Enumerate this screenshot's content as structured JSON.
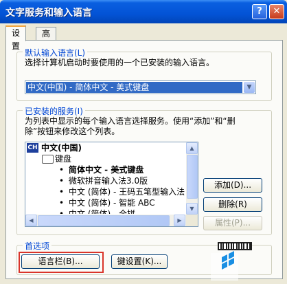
{
  "window": {
    "title": "文字服务和输入语言",
    "help_glyph": "?",
    "close_glyph": "✕"
  },
  "tabs": [
    {
      "label": "设置"
    },
    {
      "label": "高级"
    }
  ],
  "default_lang": {
    "legend": "默认输入语言(L)",
    "desc": "选择计算机启动时要使用的一个已安装的输入语言。",
    "selected": "中文(中国) - 简体中文 - 美式键盘"
  },
  "services": {
    "legend": "已安装的服务(I)",
    "desc_line1": "为列表中显示的每个输入语言选择服务。使用“添加”和“删",
    "desc_line2": "除”按钮来修改这个列表。",
    "badge": "CH",
    "items": [
      "中文(中国)",
      "键盘",
      "简体中文 - 美式键盘",
      "微软拼音输入法3.0版",
      "中文 (简体) - 王码五笔型输入法",
      "中文 (简体) - 智能 ABC",
      "中文 (简体) - 全拼"
    ],
    "add_button": "添加(D)...",
    "remove_button": "删除(R)",
    "props_button": "属性(P)..."
  },
  "prefs": {
    "legend": "首选项",
    "langbar_button": "语言栏(B)...",
    "keyset_button": "键设置(K)..."
  }
}
